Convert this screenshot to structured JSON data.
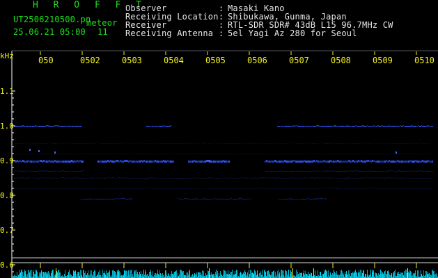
{
  "header": {
    "program": "H R O F F T",
    "filename": "UT2506210500.pn",
    "tag": "meteor",
    "datetime": "25.06.21 05:00",
    "count": "11"
  },
  "info": {
    "rows": [
      {
        "key": "Observer",
        "sep": ":",
        "value": "Masaki Kano"
      },
      {
        "key": "Receiving Location",
        "sep": ":",
        "value": "Shibukawa, Gunma, Japan"
      },
      {
        "key": "Receiver",
        "sep": ":",
        "value": "RTL-SDR SDR# 43dB L15 96.7MHz CW"
      },
      {
        "key": "Receiving Antenna",
        "sep": ":",
        "value": "5el Yagi Az 280 for Seoul"
      }
    ]
  },
  "spectrogram": {
    "y_unit": "kHz",
    "y_ticks": [
      "1.1",
      "1.0",
      "0.9",
      "0.8",
      "0.7",
      "0.6"
    ],
    "time_labels": [
      "050",
      "0502",
      "0503",
      "0504",
      "0505",
      "0506",
      "0507",
      "0508",
      "0509",
      "0510"
    ],
    "colors": {
      "background": "#000000",
      "signal": "#3355ff",
      "axis": "#ffffff",
      "label": "#f2f21e",
      "noise": "#00e0ff"
    }
  }
}
